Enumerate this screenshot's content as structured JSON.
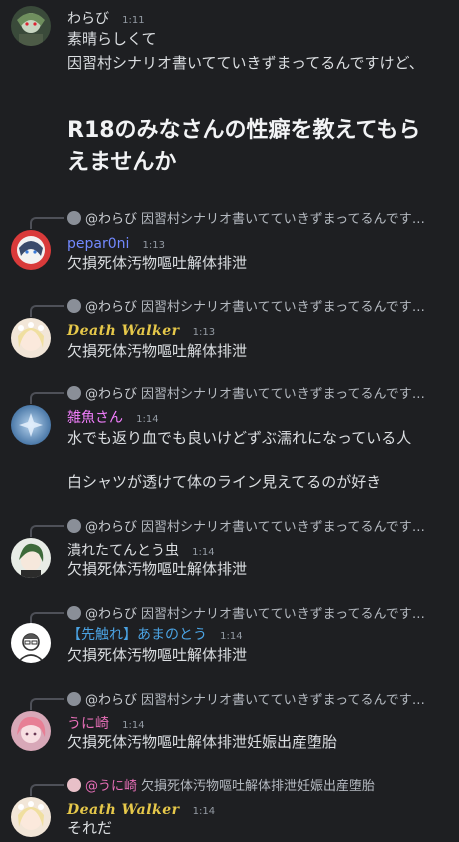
{
  "messages": [
    {
      "author": "わらび",
      "author_color": "#dbdee1",
      "time": "1:11",
      "lines": [
        "素晴らしくて",
        "因習村シナリオ書いてていきずまってるんですけど、"
      ],
      "big_text": "R18のみなさんの性癖を教えてもらえませんか"
    },
    {
      "reply_to": "@わらび",
      "reply_text": "因習村シナリオ書いてていきずまってるんですけど、",
      "author": "pepar0ni",
      "author_color": "#7289ff",
      "time": "1:13",
      "lines": [
        "欠損死体汚物嘔吐解体排泄"
      ]
    },
    {
      "reply_to": "@わらび",
      "reply_text": "因習村シナリオ書いてていきずまってるんですけど、",
      "author": "Death Walker",
      "author_color": "#e6c84a",
      "time": "1:13",
      "lines": [
        "欠損死体汚物嘔吐解体排泄"
      ]
    },
    {
      "reply_to": "@わらび",
      "reply_text": "因習村シナリオ書いてていきずまってるんですけど、",
      "author": "雑魚さん",
      "author_color": "#f47fff",
      "time": "1:14",
      "lines": [
        "水でも返り血でも良いけどずぶ濡れになっている人",
        "白シャツが透けて体のライン見えてるのが好き"
      ]
    },
    {
      "reply_to": "@わらび",
      "reply_text": "因習村シナリオ書いてていきずまってるんですけど、",
      "author": "潰れたてんとう虫",
      "author_color": "#dbdee1",
      "time": "1:14",
      "lines": [
        "欠損死体汚物嘔吐解体排泄"
      ]
    },
    {
      "reply_to": "@わらび",
      "reply_text": "因習村シナリオ書いてていきずまってるんですけど、",
      "author": "【先触れ】あまのとう",
      "author_color": "#4ba3e3",
      "time": "1:14",
      "lines": [
        "欠損死体汚物嘔吐解体排泄"
      ]
    },
    {
      "reply_to": "@わらび",
      "reply_text": "因習村シナリオ書いてていきずまってるんですけど、",
      "author": "うに崎",
      "author_color": "#e86fb8",
      "time": "1:14",
      "lines": [
        "欠損死体汚物嘔吐解体排泄妊娠出産堕胎"
      ]
    },
    {
      "reply_to": "@うに崎",
      "reply_to_color": "#e86fb8",
      "reply_text": "欠損死体汚物嘔吐解体排泄妊娠出産堕胎",
      "author": "Death Walker",
      "author_color": "#e6c84a",
      "time": "1:14",
      "lines": [
        "それだ"
      ]
    }
  ]
}
